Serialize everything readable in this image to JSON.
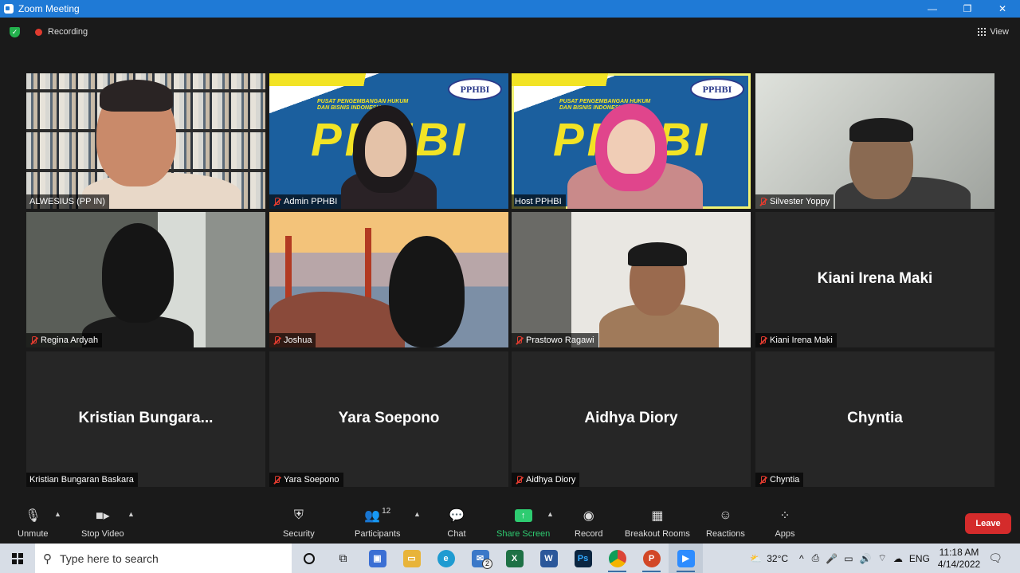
{
  "window": {
    "title": "Zoom Meeting",
    "min": "—",
    "max": "❐",
    "close": "✕"
  },
  "meeting_bar": {
    "recording": "Recording",
    "view": "View"
  },
  "tiles": [
    {
      "label": "ALWESIUS (PP IN)",
      "muted": false,
      "video": true
    },
    {
      "label": "Admin PPHBI",
      "muted": true,
      "video": true
    },
    {
      "label": "Host PPHBI",
      "muted": false,
      "video": true,
      "active": true
    },
    {
      "label": "Silvester Yoppy",
      "muted": true,
      "video": true
    },
    {
      "label": "Regina Ardyah",
      "muted": true,
      "video": true
    },
    {
      "label": "Joshua",
      "muted": true,
      "video": true
    },
    {
      "label": "Prastowo Ragawi",
      "muted": true,
      "video": true
    },
    {
      "label": "Kiani Irena Maki",
      "muted": true,
      "video": false,
      "display_name": "Kiani Irena Maki"
    },
    {
      "label": "Kristian Bungaran Baskara",
      "muted": false,
      "video": false,
      "display_name": "Kristian  Bungara..."
    },
    {
      "label": "Yara Soepono",
      "muted": true,
      "video": false,
      "display_name": "Yara Soepono"
    },
    {
      "label": "Aidhya Diory",
      "muted": true,
      "video": false,
      "display_name": "Aidhya Diory"
    },
    {
      "label": "Chyntia",
      "muted": true,
      "video": false,
      "display_name": "Chyntia"
    }
  ],
  "pphbi_banner": {
    "logo": "PPHBI",
    "headline": "PPHBI",
    "subtitle": "PUSAT PENGEMBANGAN HUKUM DAN BISNIS INDONESIA"
  },
  "toolbar": {
    "unmute": "Unmute",
    "stop_video": "Stop Video",
    "security": "Security",
    "participants": "Participants",
    "participants_count": "12",
    "chat": "Chat",
    "share_screen": "Share Screen",
    "record": "Record",
    "breakout_rooms": "Breakout Rooms",
    "reactions": "Reactions",
    "apps": "Apps",
    "leave": "Leave"
  },
  "taskbar": {
    "search_placeholder": "Type here to search",
    "temperature": "32°C",
    "language": "ENG",
    "time": "11:18 AM",
    "date": "4/14/2022",
    "mail_badge": "2"
  },
  "colors": {
    "accent": "#1f7ad6",
    "leave": "#d42b2b",
    "share": "#2ecc71",
    "active_speaker": "#f3f373"
  }
}
